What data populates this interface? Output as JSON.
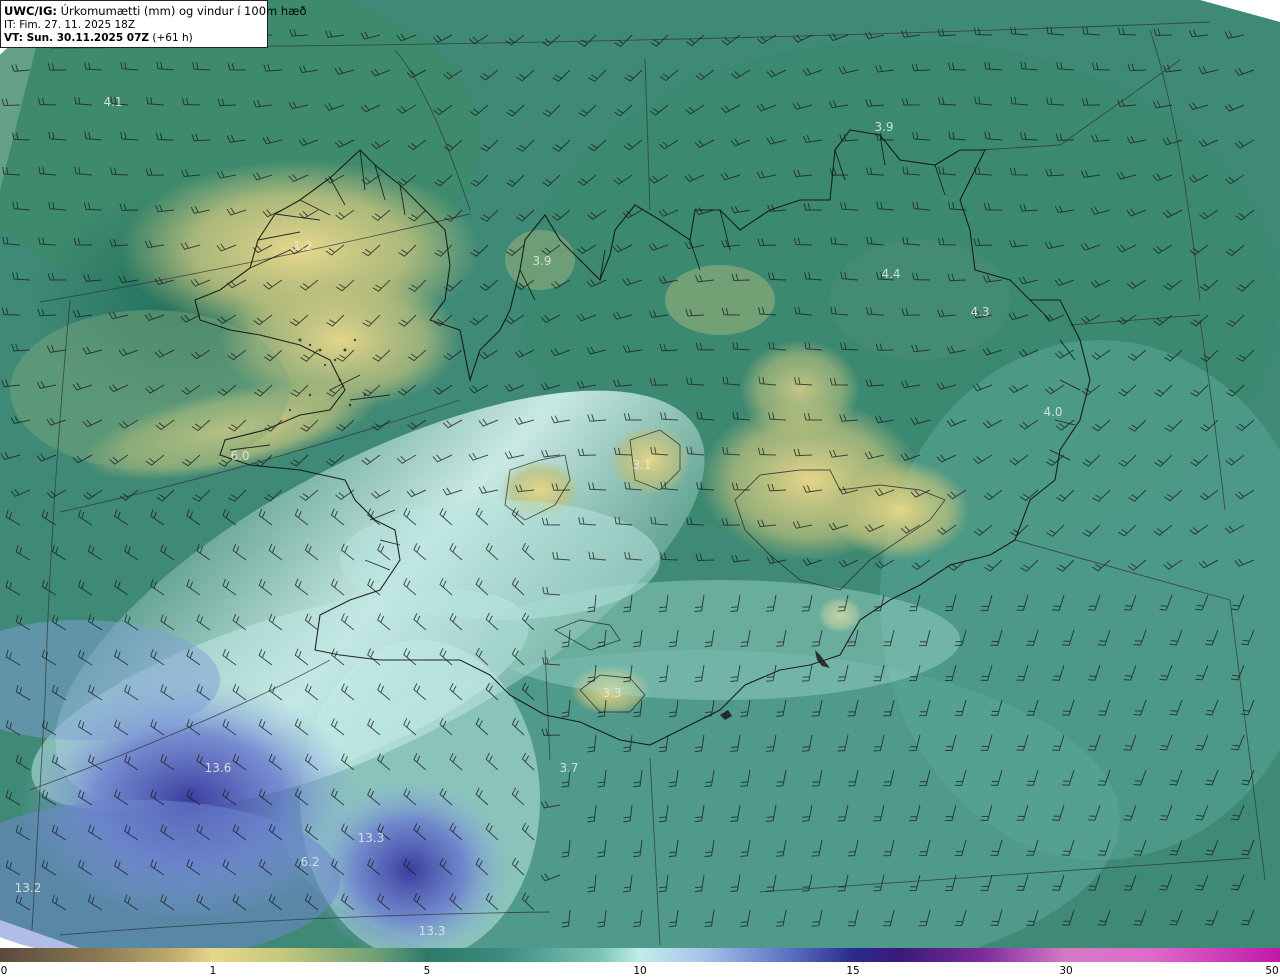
{
  "header": {
    "product": "UWC/IG:",
    "title": "Úrkomumætti (mm) og vindur í 100m hæð",
    "issue_time": "IT: Fim. 27. 11. 2025 18Z",
    "valid_prefix": "VT: Sun. 30.11.2025 07Z",
    "valid_suffix": "(+61 h)"
  },
  "map_values": [
    {
      "id": "nw-sea",
      "label": "4.1"
    },
    {
      "id": "westfjords",
      "label": "1.2"
    },
    {
      "id": "skagi",
      "label": "3.9"
    },
    {
      "id": "north-coast",
      "label": "3.9"
    },
    {
      "id": "northeast",
      "label": "4.4"
    },
    {
      "id": "east",
      "label": "4.3"
    },
    {
      "id": "east-coast",
      "label": "4.0"
    },
    {
      "id": "snaefellsnes",
      "label": "6.0"
    },
    {
      "id": "langjokull",
      "label": "3.1"
    },
    {
      "id": "eyjafjallajokull",
      "label": "3.3"
    },
    {
      "id": "south-sea",
      "label": "3.7"
    },
    {
      "id": "sw-sea-1",
      "label": "13.6"
    },
    {
      "id": "sw-sea-2",
      "label": "13.3"
    },
    {
      "id": "sw-sea-3",
      "label": "6.2"
    },
    {
      "id": "sw-corner",
      "label": "13.2"
    },
    {
      "id": "south-bottom",
      "label": "13.3"
    }
  ],
  "colorbar": {
    "ticks": [
      "0",
      "1",
      "5",
      "10",
      "15",
      "30",
      "50"
    ]
  },
  "colors": {
    "background": "#ffffff",
    "low_precip": "#e6d78a",
    "mid_precip": "#2e7a6a",
    "high_precip": "#5a70c2",
    "extreme_precip": "#c018a8",
    "coastline": "#111111"
  }
}
